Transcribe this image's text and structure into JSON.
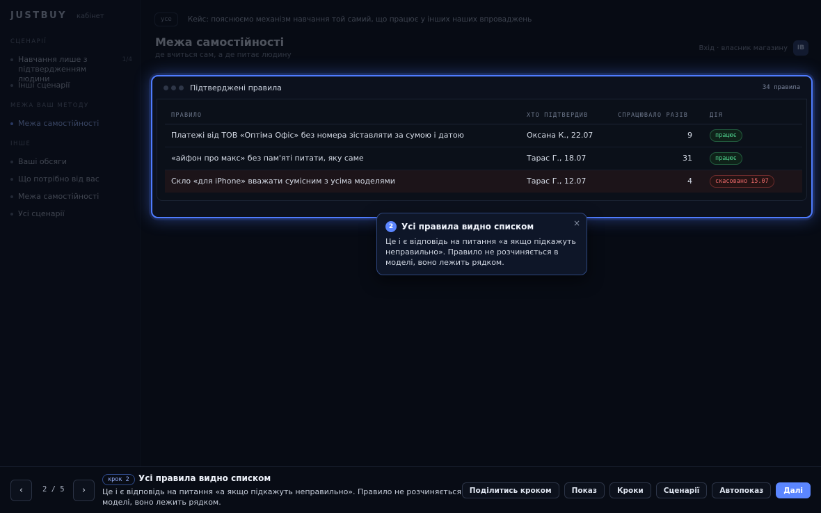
{
  "app": {
    "brand": "JUSTBUY",
    "brand_sub": "кабінет"
  },
  "sidebar": {
    "sections": [
      {
        "head": "СЦЕНАРІЇ"
      },
      {
        "head": "МЕЖА ВАШ МЕТОДУ"
      },
      {
        "head": "ІНШЕ"
      }
    ],
    "items": [
      {
        "label": "Навчання лише з підтвердженням людини",
        "count": "1/4"
      },
      {
        "label": "Інші сценарії"
      },
      {
        "label": "Межа самостійності"
      },
      {
        "label": "Ваші обсяги"
      },
      {
        "label": "Що потрібно від вас"
      },
      {
        "label": "Межа самостійності"
      },
      {
        "label": "Усі сценарії"
      }
    ]
  },
  "topbar": {
    "pill": "усе",
    "crumb": "Кейс: пояснюємо механізм навчання той самий, що працює у інших наших впроваджень"
  },
  "header": {
    "title": "Межа самостійності",
    "subtitle": "де вчиться сам, а де питає людину",
    "right_text": "Вхід · власник магазину",
    "avatar": "ІВ"
  },
  "card": {
    "title": "Підтверджені правила",
    "count": "34 правила",
    "columns": [
      "ПРАВИЛО",
      "ХТО ПІДТВЕРДИВ",
      "СПРАЦЮВАЛО РАЗІВ",
      "ДІЯ"
    ],
    "rows": [
      {
        "rule": "Платежі від ТОВ «Оптіма Офіс» без номера зіставляти за сумою і датою",
        "who": "Оксана К., 22.07",
        "times": "9",
        "status": "працює",
        "state": "ok"
      },
      {
        "rule": "«айфон про макс» без пам'яті питати, яку саме",
        "who": "Тарас Г., 18.07",
        "times": "31",
        "status": "працює",
        "state": "ok"
      },
      {
        "rule": "Скло «для iPhone» вважати сумісним з усіма моделями",
        "who": "Тарас Г., 12.07",
        "times": "4",
        "status": "скасовано 15.07",
        "state": "cancel"
      }
    ]
  },
  "tooltip": {
    "num": "2",
    "title": "Усі правила видно списком",
    "body": "Це і є відповідь на питання «а якщо підкажуть неправильно». Правило не розчиняється в моделі, воно лежить рядком.",
    "close": "×"
  },
  "tour": {
    "prev": "‹",
    "next": "›",
    "pager": "2 / 5",
    "step_pill": "крок 2",
    "title": "Усі правила видно списком",
    "body": "Це і є відповідь на питання «а якщо підкажуть неправильно». Правило не розчиняється в моделі, воно лежить рядком.",
    "actions": [
      "Поділитись кроком",
      "Показ",
      "Кроки",
      "Сценарії",
      "Автопоказ",
      "Далі"
    ]
  },
  "colors": {
    "accent": "#5b86ff",
    "ok": "#4fd38e",
    "cancel": "#f06b6b",
    "background": "#070b14"
  }
}
